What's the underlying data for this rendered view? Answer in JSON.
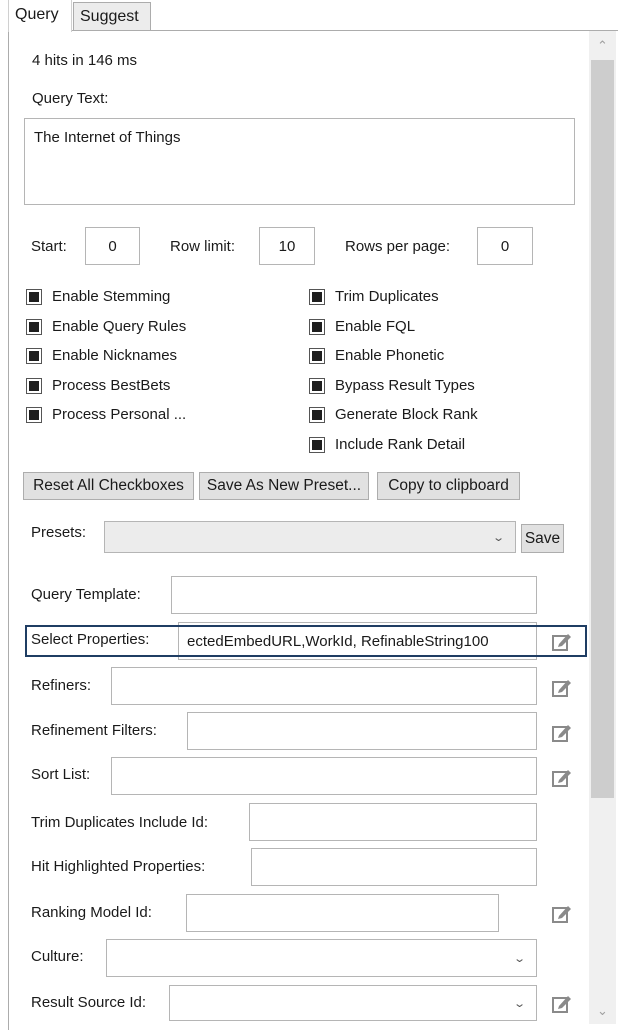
{
  "tabs": [
    {
      "label": "Query",
      "active": true
    },
    {
      "label": "Suggest",
      "active": false
    }
  ],
  "status": "4 hits in 146 ms",
  "query_text": {
    "label": "Query Text:",
    "value": "The Internet of Things"
  },
  "paging": {
    "start_label": "Start:",
    "start_value": "0",
    "row_limit_label": "Row limit:",
    "row_limit_value": "10",
    "rows_per_page_label": "Rows per page:",
    "rows_per_page_value": "0"
  },
  "checkboxes_left": [
    {
      "label": "Enable Stemming",
      "checked": true
    },
    {
      "label": "Enable Query Rules",
      "checked": true
    },
    {
      "label": "Enable Nicknames",
      "checked": true
    },
    {
      "label": "Process BestBets",
      "checked": true
    },
    {
      "label": "Process Personal ...",
      "checked": true
    }
  ],
  "checkboxes_right": [
    {
      "label": "Trim Duplicates",
      "checked": true
    },
    {
      "label": "Enable FQL",
      "checked": true
    },
    {
      "label": "Enable Phonetic",
      "checked": true
    },
    {
      "label": "Bypass Result Types",
      "checked": true
    },
    {
      "label": "Generate Block Rank",
      "checked": true
    },
    {
      "label": "Include Rank Detail",
      "checked": true
    }
  ],
  "actions": {
    "reset": "Reset All Checkboxes",
    "save_preset": "Save As New Preset...",
    "copy": "Copy to clipboard"
  },
  "presets": {
    "label": "Presets:",
    "selected": "",
    "save_label": "Save"
  },
  "fields": {
    "query_template": {
      "label": "Query Template:",
      "value": ""
    },
    "select_properties": {
      "label": "Select Properties:",
      "value": "ectedEmbedURL,WorkId, RefinableString100"
    },
    "refiners": {
      "label": "Refiners:",
      "value": ""
    },
    "refinement_filters": {
      "label": "Refinement Filters:",
      "value": ""
    },
    "sort_list": {
      "label": "Sort List:",
      "value": ""
    },
    "trim_duplicates_include_id": {
      "label": "Trim Duplicates Include Id:",
      "value": ""
    },
    "hit_highlighted_properties": {
      "label": "Hit Highlighted Properties:",
      "value": ""
    },
    "ranking_model_id": {
      "label": "Ranking Model Id:",
      "value": ""
    },
    "culture": {
      "label": "Culture:",
      "selected": ""
    },
    "result_source_id": {
      "label": "Result Source Id:",
      "selected": ""
    }
  },
  "icons": {
    "edit": "edit-icon",
    "chevron_down": "chevron-down-icon",
    "scroll_up": "scroll-up-arrow",
    "scroll_down": "scroll-down-arrow"
  },
  "colors": {
    "highlight_border": "#1f3d63",
    "button_bg": "#e1e1e1",
    "scroll_thumb": "#cdcdcd"
  }
}
